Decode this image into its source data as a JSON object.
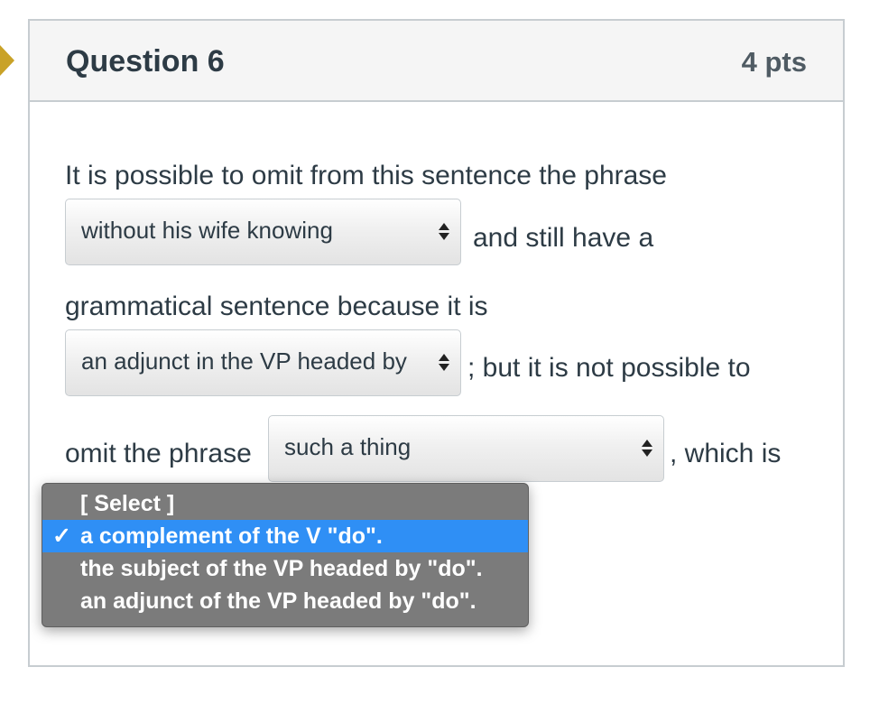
{
  "question": {
    "title": "Question 6",
    "points": "4 pts"
  },
  "body": {
    "line1": "It is possible to omit from this sentence the phrase",
    "after_select1": "and still have a",
    "line3": "grammatical sentence because it is",
    "after_select2": "; but it is not possible to",
    "before_select3": "omit the phrase",
    "after_select3": ", which is"
  },
  "selects": [
    {
      "value": "without his wife knowing"
    },
    {
      "value": "an adjunct in the VP headed by"
    },
    {
      "value": "such a thing"
    }
  ],
  "dropdown": {
    "options": [
      {
        "label": "[ Select ]",
        "selected": false
      },
      {
        "label": "a complement of the V \"do\".",
        "selected": true
      },
      {
        "label": "the subject of the VP headed by \"do\".",
        "selected": false
      },
      {
        "label": "an adjunct of the VP headed by \"do\".",
        "selected": false
      }
    ],
    "check_mark": "✓"
  },
  "colors": {
    "accent": "#2f8ff5",
    "marker": "#c9a227",
    "menu_bg": "#7b7b7b"
  }
}
